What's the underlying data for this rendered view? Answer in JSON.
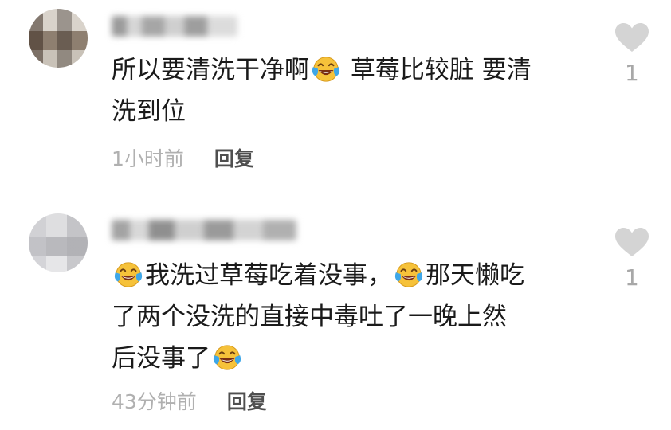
{
  "comments": [
    {
      "username": "",
      "text_lines": [
        [
          "所以要清洗干净啊",
          "emoji",
          " 草莓比较脏 要清"
        ],
        [
          "洗到位"
        ]
      ],
      "line1_part1": "所以要清洗干净啊",
      "line1_part2": " 草莓比较脏 要清",
      "line2": "洗到位",
      "timestamp": "1小时前",
      "reply_label": "回复",
      "like_count": "1",
      "like_icon": "heart-icon",
      "emoji_icon": "tears-of-joy-emoji"
    },
    {
      "username": "",
      "line1_part1": "我洗过草莓吃着没事，",
      "line1_part2": "那天懒吃",
      "line2": "了两个没洗的直接中毒吐了一晚上然",
      "line3": "后没事了",
      "timestamp": "43分钟前",
      "reply_label": "回复",
      "like_count": "1",
      "like_icon": "heart-icon",
      "emoji_icon": "tears-of-joy-emoji"
    }
  ],
  "colors": {
    "text": "#1a1a1a",
    "timestamp": "#b0b0b0",
    "reply": "#4f4f4f",
    "like_icon": "#d4d4d4",
    "like_count": "#a8a8a8",
    "emoji_face": "#f6c23a",
    "emoji_tears": "#3fa7e8"
  }
}
